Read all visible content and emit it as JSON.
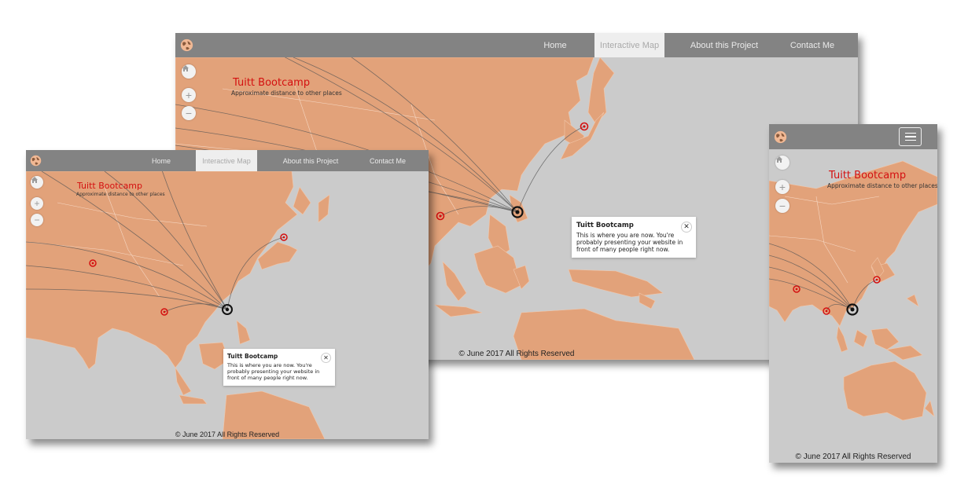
{
  "nav": {
    "items": [
      {
        "label": "Home"
      },
      {
        "label": "Interactive Map"
      },
      {
        "label": "About this Project"
      },
      {
        "label": "Contact Me"
      }
    ],
    "active_item": "Interactive Map",
    "logo_icon": "globe-icon",
    "menu_icon": "hamburger-menu-icon"
  },
  "map": {
    "controls": {
      "home_icon": "home-icon",
      "zoom_in": "+",
      "zoom_out": "−"
    },
    "title": "Tuitt Bootcamp",
    "subtitle": "Approximate distance to other places",
    "title_icon": "plane-icon"
  },
  "popup": {
    "title": "Tuitt Bootcamp",
    "body": "This is where you are now. You're probably presenting your website in front of many people right now.",
    "close_icon": "close-icon"
  },
  "footer": {
    "text": "© June 2017 All Rights Reserved"
  },
  "colors": {
    "navbar": "#838383",
    "land": "#e2a27a",
    "ocean": "#cbcbcb",
    "accent": "#d41010"
  }
}
